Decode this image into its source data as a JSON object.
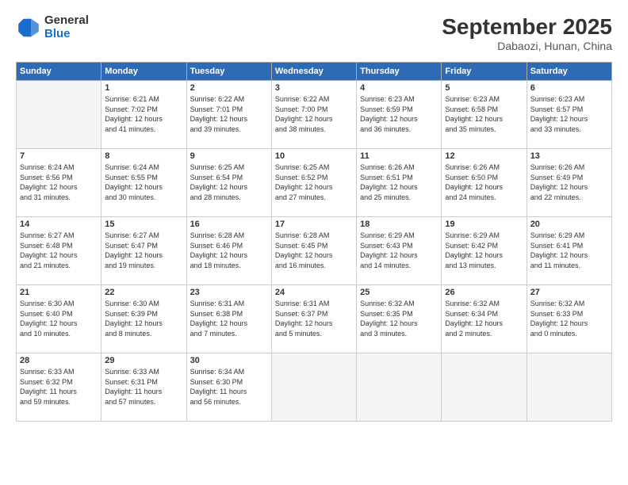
{
  "header": {
    "logo": {
      "general": "General",
      "blue": "Blue"
    },
    "title": "September 2025",
    "location": "Dabaozi, Hunan, China"
  },
  "weekdays": [
    "Sunday",
    "Monday",
    "Tuesday",
    "Wednesday",
    "Thursday",
    "Friday",
    "Saturday"
  ],
  "weeks": [
    [
      {
        "day": "",
        "info": ""
      },
      {
        "day": "1",
        "info": "Sunrise: 6:21 AM\nSunset: 7:02 PM\nDaylight: 12 hours\nand 41 minutes."
      },
      {
        "day": "2",
        "info": "Sunrise: 6:22 AM\nSunset: 7:01 PM\nDaylight: 12 hours\nand 39 minutes."
      },
      {
        "day": "3",
        "info": "Sunrise: 6:22 AM\nSunset: 7:00 PM\nDaylight: 12 hours\nand 38 minutes."
      },
      {
        "day": "4",
        "info": "Sunrise: 6:23 AM\nSunset: 6:59 PM\nDaylight: 12 hours\nand 36 minutes."
      },
      {
        "day": "5",
        "info": "Sunrise: 6:23 AM\nSunset: 6:58 PM\nDaylight: 12 hours\nand 35 minutes."
      },
      {
        "day": "6",
        "info": "Sunrise: 6:23 AM\nSunset: 6:57 PM\nDaylight: 12 hours\nand 33 minutes."
      }
    ],
    [
      {
        "day": "7",
        "info": "Sunrise: 6:24 AM\nSunset: 6:56 PM\nDaylight: 12 hours\nand 31 minutes."
      },
      {
        "day": "8",
        "info": "Sunrise: 6:24 AM\nSunset: 6:55 PM\nDaylight: 12 hours\nand 30 minutes."
      },
      {
        "day": "9",
        "info": "Sunrise: 6:25 AM\nSunset: 6:54 PM\nDaylight: 12 hours\nand 28 minutes."
      },
      {
        "day": "10",
        "info": "Sunrise: 6:25 AM\nSunset: 6:52 PM\nDaylight: 12 hours\nand 27 minutes."
      },
      {
        "day": "11",
        "info": "Sunrise: 6:26 AM\nSunset: 6:51 PM\nDaylight: 12 hours\nand 25 minutes."
      },
      {
        "day": "12",
        "info": "Sunrise: 6:26 AM\nSunset: 6:50 PM\nDaylight: 12 hours\nand 24 minutes."
      },
      {
        "day": "13",
        "info": "Sunrise: 6:26 AM\nSunset: 6:49 PM\nDaylight: 12 hours\nand 22 minutes."
      }
    ],
    [
      {
        "day": "14",
        "info": "Sunrise: 6:27 AM\nSunset: 6:48 PM\nDaylight: 12 hours\nand 21 minutes."
      },
      {
        "day": "15",
        "info": "Sunrise: 6:27 AM\nSunset: 6:47 PM\nDaylight: 12 hours\nand 19 minutes."
      },
      {
        "day": "16",
        "info": "Sunrise: 6:28 AM\nSunset: 6:46 PM\nDaylight: 12 hours\nand 18 minutes."
      },
      {
        "day": "17",
        "info": "Sunrise: 6:28 AM\nSunset: 6:45 PM\nDaylight: 12 hours\nand 16 minutes."
      },
      {
        "day": "18",
        "info": "Sunrise: 6:29 AM\nSunset: 6:43 PM\nDaylight: 12 hours\nand 14 minutes."
      },
      {
        "day": "19",
        "info": "Sunrise: 6:29 AM\nSunset: 6:42 PM\nDaylight: 12 hours\nand 13 minutes."
      },
      {
        "day": "20",
        "info": "Sunrise: 6:29 AM\nSunset: 6:41 PM\nDaylight: 12 hours\nand 11 minutes."
      }
    ],
    [
      {
        "day": "21",
        "info": "Sunrise: 6:30 AM\nSunset: 6:40 PM\nDaylight: 12 hours\nand 10 minutes."
      },
      {
        "day": "22",
        "info": "Sunrise: 6:30 AM\nSunset: 6:39 PM\nDaylight: 12 hours\nand 8 minutes."
      },
      {
        "day": "23",
        "info": "Sunrise: 6:31 AM\nSunset: 6:38 PM\nDaylight: 12 hours\nand 7 minutes."
      },
      {
        "day": "24",
        "info": "Sunrise: 6:31 AM\nSunset: 6:37 PM\nDaylight: 12 hours\nand 5 minutes."
      },
      {
        "day": "25",
        "info": "Sunrise: 6:32 AM\nSunset: 6:35 PM\nDaylight: 12 hours\nand 3 minutes."
      },
      {
        "day": "26",
        "info": "Sunrise: 6:32 AM\nSunset: 6:34 PM\nDaylight: 12 hours\nand 2 minutes."
      },
      {
        "day": "27",
        "info": "Sunrise: 6:32 AM\nSunset: 6:33 PM\nDaylight: 12 hours\nand 0 minutes."
      }
    ],
    [
      {
        "day": "28",
        "info": "Sunrise: 6:33 AM\nSunset: 6:32 PM\nDaylight: 11 hours\nand 59 minutes."
      },
      {
        "day": "29",
        "info": "Sunrise: 6:33 AM\nSunset: 6:31 PM\nDaylight: 11 hours\nand 57 minutes."
      },
      {
        "day": "30",
        "info": "Sunrise: 6:34 AM\nSunset: 6:30 PM\nDaylight: 11 hours\nand 56 minutes."
      },
      {
        "day": "",
        "info": ""
      },
      {
        "day": "",
        "info": ""
      },
      {
        "day": "",
        "info": ""
      },
      {
        "day": "",
        "info": ""
      }
    ]
  ]
}
